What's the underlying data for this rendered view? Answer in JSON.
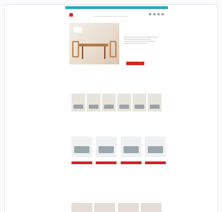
{
  "topbar": {
    "text": ""
  },
  "header": {
    "logo_text": "",
    "search_placeholder": ""
  },
  "nav": {
    "items": [
      "",
      "",
      "",
      "",
      "",
      "",
      "",
      ""
    ]
  },
  "hero": {
    "badge_text": "",
    "title": "",
    "button_label": ""
  },
  "categories_section": {
    "title": "",
    "subtitle": "",
    "items": [
      {
        "label": ""
      },
      {
        "label": ""
      },
      {
        "label": ""
      },
      {
        "label": ""
      },
      {
        "label": ""
      },
      {
        "label": ""
      }
    ]
  },
  "products_section": {
    "title": "",
    "subtitle": "",
    "items": [
      {
        "name": "",
        "price": "",
        "cta": ""
      },
      {
        "name": "",
        "price": "",
        "cta": ""
      },
      {
        "name": "",
        "price": "",
        "cta": ""
      },
      {
        "name": "",
        "price": "",
        "cta": ""
      }
    ]
  },
  "inspiration_section": {
    "title": "",
    "subtitle": ""
  },
  "colors": {
    "accent": "#d72323",
    "topbar": "#2fa5b8"
  }
}
